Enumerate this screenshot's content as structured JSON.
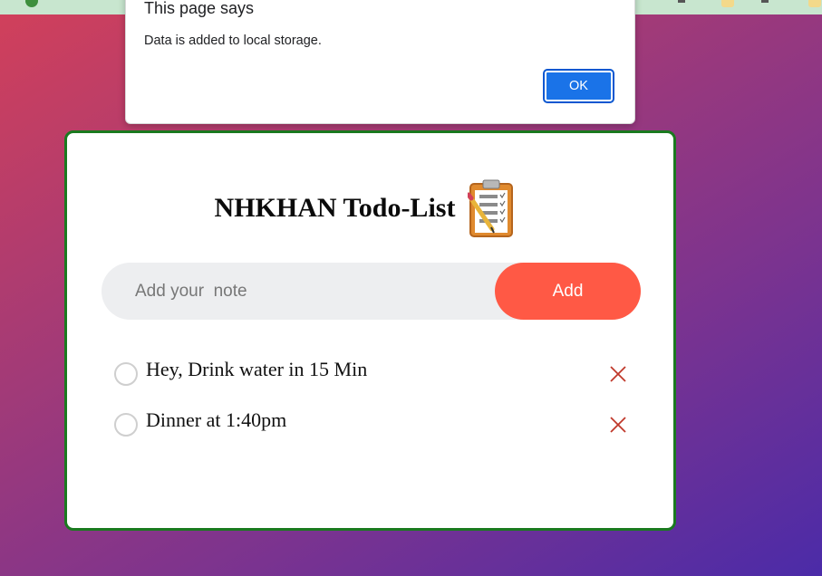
{
  "dialog": {
    "title": "This page says",
    "message": "Data is added to local storage.",
    "ok_label": "OK"
  },
  "app": {
    "title": "NHKHAN Todo-List",
    "title_icon": "clipboard-checklist-icon",
    "input": {
      "placeholder": "Add your  note",
      "value": ""
    },
    "add_label": "Add",
    "todos": [
      {
        "text": "Hey, Drink water in 15 Min",
        "checked": false
      },
      {
        "text": "Dinner at 1:40pm",
        "checked": false
      }
    ]
  },
  "colors": {
    "add_button": "#ff5945",
    "card_border": "#1a7a1f",
    "delete_icon": "#c0392b",
    "ok_button": "#1a73e8"
  }
}
